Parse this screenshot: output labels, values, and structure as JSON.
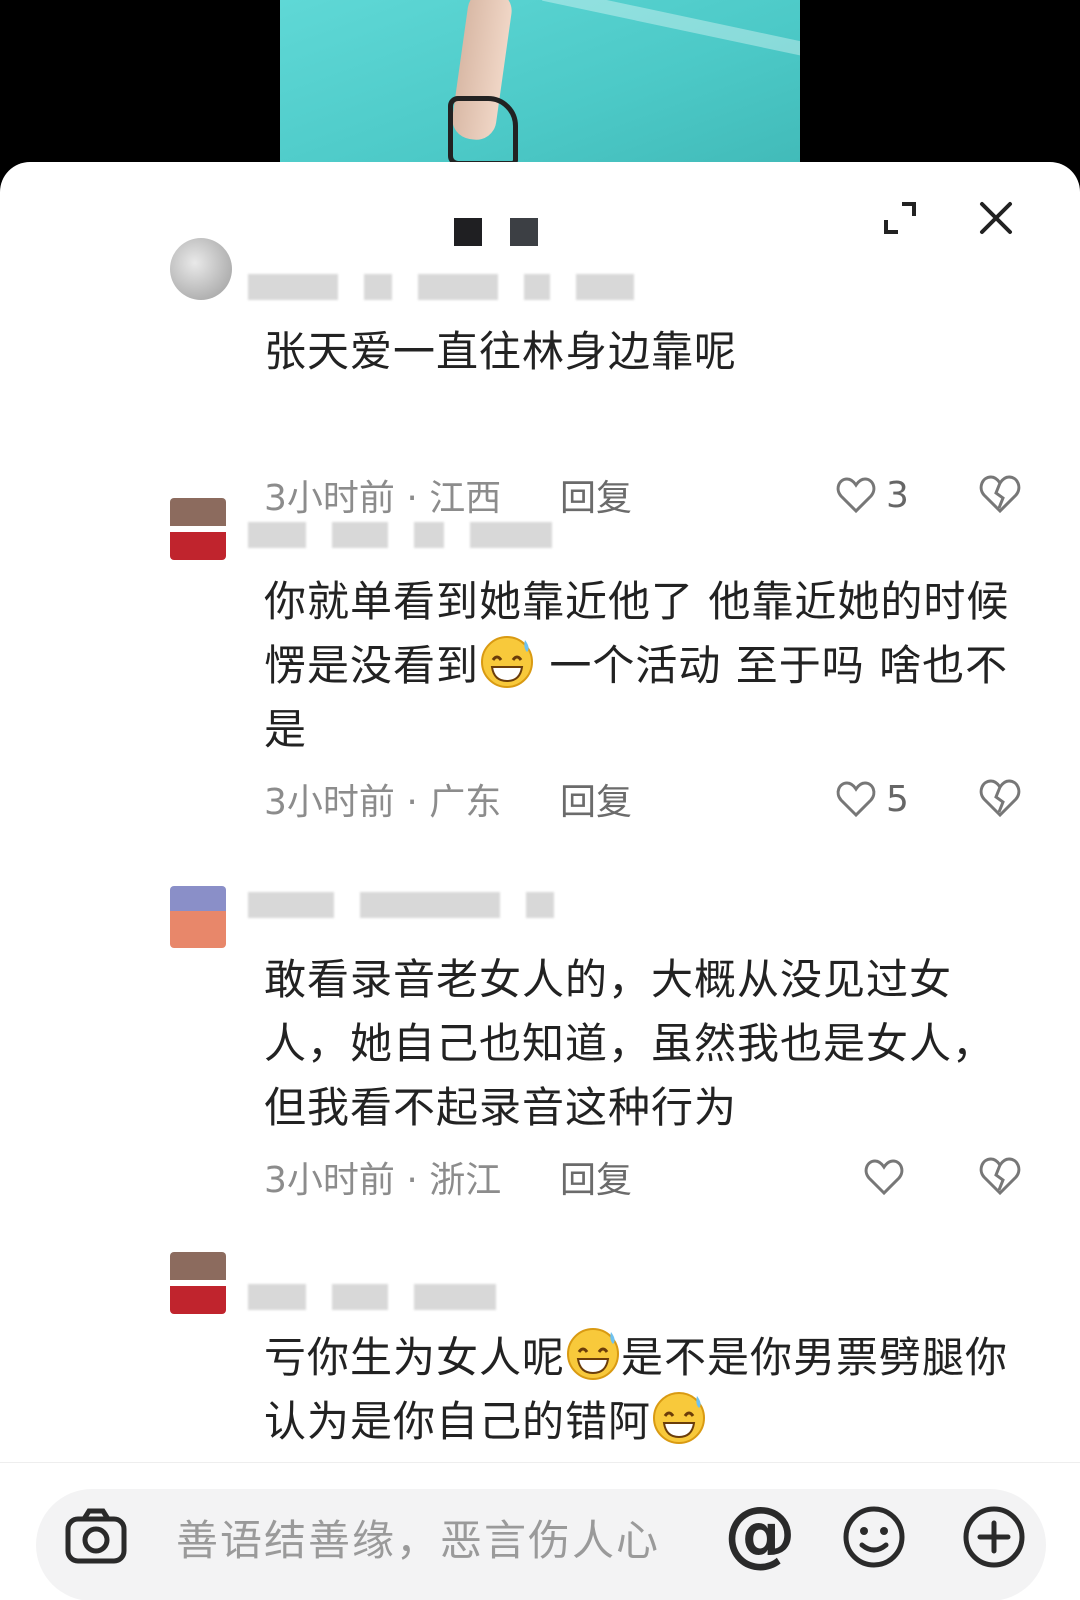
{
  "comments": [
    {
      "text": "张天爱一直往林身边靠呢",
      "time_location": "3小时前 · 江西",
      "reply_label": "回复",
      "like_count": "3"
    },
    {
      "text_a": "你就单看到她靠近他了 他靠近她的时候愣是没看到",
      "text_b": " 一个活动 至于吗 啥也不是",
      "time_location": "3小时前 · 广东",
      "reply_label": "回复",
      "like_count": "5"
    },
    {
      "text": "敢看录音老女人的，大概从没见过女人，她自己也知道，虽然我也是女人，但我看不起录音这种行为",
      "time_location": "3小时前 · 浙江",
      "reply_label": "回复",
      "like_count": ""
    },
    {
      "text_a": "亏你生为女人呢",
      "text_b": "是不是你男票劈腿你认为是你自己的错阿"
    }
  ],
  "input": {
    "placeholder": "善语结善缘，恶言伤人心",
    "at_label": "@"
  },
  "icons": {
    "expand": "expand-icon",
    "close": "close-icon",
    "like": "heart-outline-icon",
    "dislike": "broken-heart-icon",
    "camera": "camera-icon",
    "emoji": "emoji-icon",
    "add": "plus-circle-icon"
  }
}
